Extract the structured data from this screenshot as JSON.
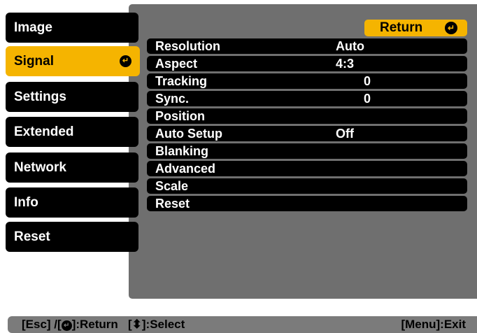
{
  "menu": {
    "items": [
      {
        "label": "Image"
      },
      {
        "label": "Signal"
      },
      {
        "label": "Settings"
      },
      {
        "label": "Extended"
      },
      {
        "label": "Network"
      },
      {
        "label": "Info"
      },
      {
        "label": "Reset"
      }
    ],
    "active_index": 1,
    "active_icon": "enter-icon"
  },
  "panel": {
    "return_label": "Return",
    "return_icon": "enter-icon",
    "rows": [
      {
        "label": "Resolution",
        "value": "Auto"
      },
      {
        "label": "Aspect",
        "value": "4:3"
      },
      {
        "label": "Tracking",
        "value": "0"
      },
      {
        "label": "Sync.",
        "value": "0"
      },
      {
        "label": "Position",
        "value": ""
      },
      {
        "label": "Auto Setup",
        "value": "Off"
      },
      {
        "label": "Blanking",
        "value": ""
      },
      {
        "label": "Advanced",
        "value": ""
      },
      {
        "label": "Scale",
        "value": ""
      },
      {
        "label": "Reset",
        "value": ""
      }
    ]
  },
  "footer": {
    "esc": "[Esc]",
    "return_prefix": " /[",
    "return_suffix": "]:Return",
    "select_prefix": "   [",
    "select_suffix": "]:Select",
    "exit": "[Menu]:Exit",
    "return_icon": "enter-icon",
    "select_icon": "up-down-arrow-icon"
  },
  "colors": {
    "accent": "#f5b400",
    "panel": "#6f6f6f",
    "row": "#000000",
    "footer": "#7b7b7b"
  }
}
